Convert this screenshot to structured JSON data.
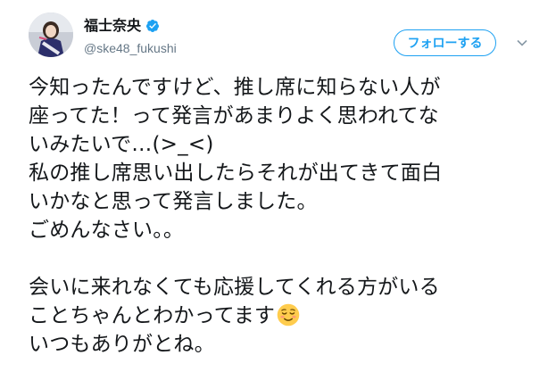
{
  "header": {
    "display_name": "福士奈央",
    "handle": "@ske48_fukushi",
    "verified_icon": "verified-badge-icon",
    "follow_label": "フォローする",
    "more_icon": "chevron-down-icon",
    "accent_color": "#1da1f2"
  },
  "tweet": {
    "lines": [
      "今知ったんですけど、推し席に知らない人が",
      "座ってた！って発言があまりよく思われてな",
      "いみたいで…(>_<)",
      "私の推し席思い出したらそれが出てきて面白",
      "いかなと思って発言しました。",
      "ごめんなさい。。",
      "",
      "会いに来れなくても応援してくれる方がいる",
      "ことちゃんとわかってます",
      "いつもありがとね。"
    ],
    "emoji_icon": "relieved-face-emoji-icon"
  }
}
